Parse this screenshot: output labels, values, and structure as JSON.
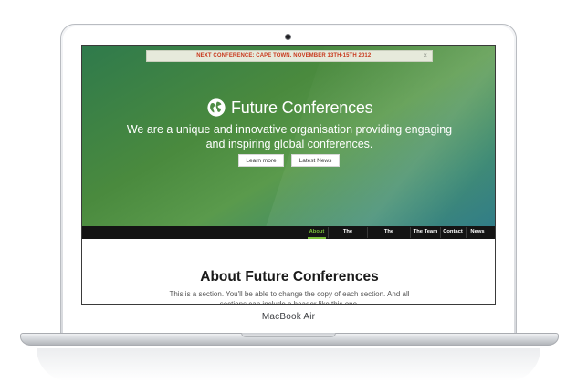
{
  "device": {
    "model_label": "MacBook Air"
  },
  "site": {
    "notice": {
      "text": "| NEXT CONFERENCE: CAPE TOWN, NOVEMBER 13TH-15TH 2012",
      "close_glyph": "×",
      "color": "#c8381c"
    },
    "brand": {
      "name": "Future Conferences",
      "icon": "globe-icon"
    },
    "tagline": "We are a unique and innovative organisation providing engaging and inspiring global conferences.",
    "buttons": {
      "learn_more": "Learn more",
      "latest_news": "Latest News"
    },
    "nav": {
      "items": [
        {
          "label": "About",
          "active": true
        },
        {
          "label": "The Workshop",
          "active": false
        },
        {
          "label": "The Conference",
          "active": false
        },
        {
          "label": "The Team",
          "active": false
        },
        {
          "label": "Contact",
          "active": false
        },
        {
          "label": "News",
          "active": false
        }
      ],
      "active_color": "#7abf3a"
    },
    "section": {
      "title": "About Future Conferences",
      "copy": "This is a section. You'll be able to change the copy of each section. And all sections can include a header like this one."
    }
  }
}
